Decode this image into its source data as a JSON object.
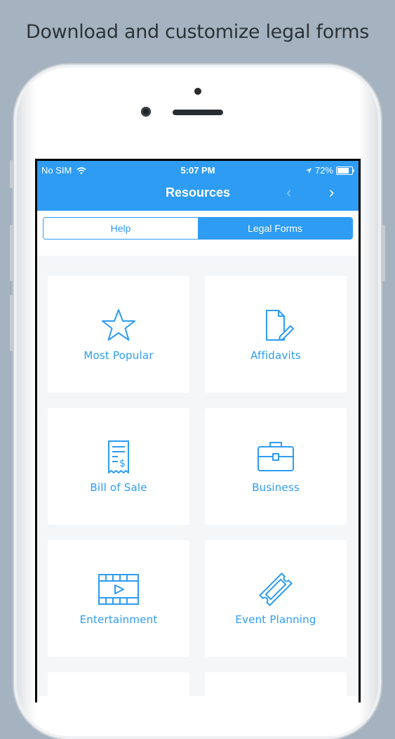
{
  "headline": "Download and customize legal forms",
  "status_bar": {
    "carrier": "No SIM",
    "time": "5:07 PM",
    "battery": "72%"
  },
  "nav": {
    "title": "Resources",
    "prev_icon": "chevron-left-icon",
    "next_icon": "chevron-right-icon"
  },
  "segments": {
    "help": "Help",
    "legal_forms": "Legal Forms",
    "selected": "legal_forms"
  },
  "categories": [
    {
      "label": "Most Popular",
      "icon": "star-icon"
    },
    {
      "label": "Affidavits",
      "icon": "document-pencil-icon"
    },
    {
      "label": "Bill of Sale",
      "icon": "receipt-icon"
    },
    {
      "label": "Business",
      "icon": "briefcase-icon"
    },
    {
      "label": "Entertainment",
      "icon": "film-icon"
    },
    {
      "label": "Event Planning",
      "icon": "ticket-icon"
    }
  ],
  "colors": {
    "accent": "#2e9cf2",
    "background": "#a4b3bf"
  }
}
